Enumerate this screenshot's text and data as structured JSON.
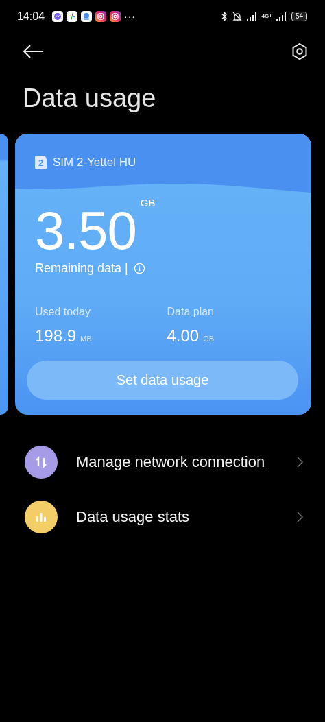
{
  "status_bar": {
    "time": "14:04",
    "overflow": "···",
    "network_type": "4G+",
    "battery": "54"
  },
  "header": {
    "title": "Data usage"
  },
  "card": {
    "sim_badge": "2",
    "sim_name": "SIM 2-Yettel HU",
    "remaining": {
      "value": "3.50",
      "unit": "GB",
      "label": "Remaining data |"
    },
    "stats": [
      {
        "label": "Used today",
        "value": "198.9",
        "unit": "MB"
      },
      {
        "label": "Data plan",
        "value": "4.00",
        "unit": "GB"
      }
    ],
    "button": "Set data usage"
  },
  "menu": [
    {
      "label": "Manage network connection",
      "color": "#a69be6"
    },
    {
      "label": "Data usage stats",
      "color": "#f3cd67"
    }
  ]
}
